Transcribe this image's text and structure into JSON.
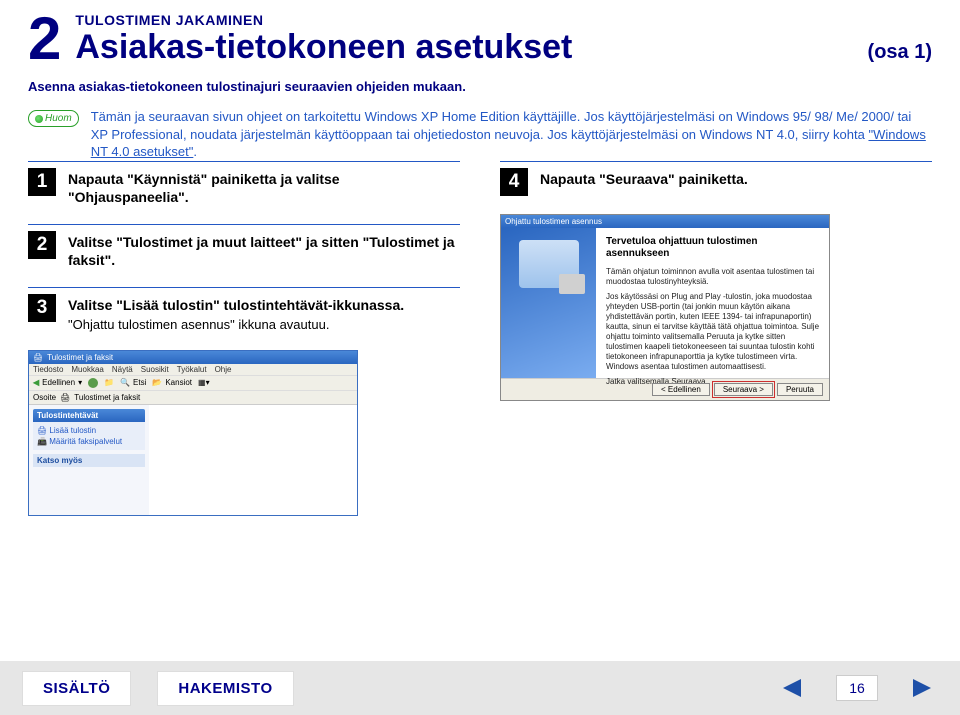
{
  "header": {
    "chapter_number": "2",
    "subtitle": "TULOSTIMEN JAKAMINEN",
    "title": "Asiakas-tietokoneen asetukset",
    "part": "(osa 1)"
  },
  "intro": "Asenna asiakas-tietokoneen tulostinajuri seuraavien ohjeiden mukaan.",
  "note": {
    "badge": "Huom",
    "text_before_link": "Tämän ja seuraavan sivun ohjeet on tarkoitettu Windows XP Home Edition käyttäjille. Jos käyttöjärjestelmäsi on Windows 95/ 98/ Me/ 2000/ tai XP Professional, noudata järjestelmän käyttöoppaan tai ohjetiedoston neuvoja. Jos käyttöjärjestelmäsi on Windows NT 4.0, siirry kohta ",
    "link_text": "\"Windows NT 4.0 asetukset\"",
    "text_after_link": "."
  },
  "steps": {
    "s1": {
      "num": "1",
      "title": "Napauta \"Käynnistä\" painiketta ja valitse \"Ohjauspaneelia\"."
    },
    "s2": {
      "num": "2",
      "title": "Valitse \"Tulostimet ja muut laitteet\" ja sitten \"Tulostimet ja faksit\"."
    },
    "s3": {
      "num": "3",
      "title": "Valitse \"Lisää tulostin\" tulostintehtävät-ikkunassa.",
      "sub": "\"Ohjattu tulostimen asennus\" ikkuna avautuu."
    },
    "s4": {
      "num": "4",
      "title": "Napauta \"Seuraava\" painiketta."
    }
  },
  "shot1": {
    "title": "Tulostimet ja faksit",
    "menu": [
      "Tiedosto",
      "Muokkaa",
      "Näytä",
      "Suosikit",
      "Työkalut",
      "Ohje"
    ],
    "back": "Edellinen",
    "search": "Etsi",
    "folders": "Kansiot",
    "addr_label": "Osoite",
    "addr_value": "Tulostimet ja faksit",
    "panel1": "Tulostintehtävät",
    "task1": "Lisää tulostin",
    "task2": "Määritä faksipalvelut",
    "panel2": "Katso myös"
  },
  "shot2": {
    "title": "Ohjattu tulostimen asennus",
    "heading": "Tervetuloa ohjattuun tulostimen asennukseen",
    "body1": "Tämän ohjatun toiminnon avulla voit asentaa tulostimen tai muodostaa tulostinyhteyksiä.",
    "body2": "Jos käytössäsi on Plug and Play -tulostin, joka muodostaa yhteyden USB-portin (tai jonkin muun käytön aikana yhdistettävän portin, kuten IEEE 1394- tai infrapunaportin) kautta, sinun ei tarvitse käyttää tätä ohjattua toimintoa. Sulje ohjattu toiminto valitsemalla Peruuta ja kytke sitten tulostimen kaapeli tietokoneeseen tai suuntaa tulostin kohti tietokoneen infrapunaporttia ja kytke tulostimeen virta. Windows asentaa tulostimen automaattisesti.",
    "body3": "Jatka valitsemalla Seuraava.",
    "btn_back": "< Edellinen",
    "btn_next": "Seuraava >",
    "btn_cancel": "Peruuta"
  },
  "footer": {
    "contents": "SISÄLTÖ",
    "index": "HAKEMISTO",
    "page": "16"
  }
}
